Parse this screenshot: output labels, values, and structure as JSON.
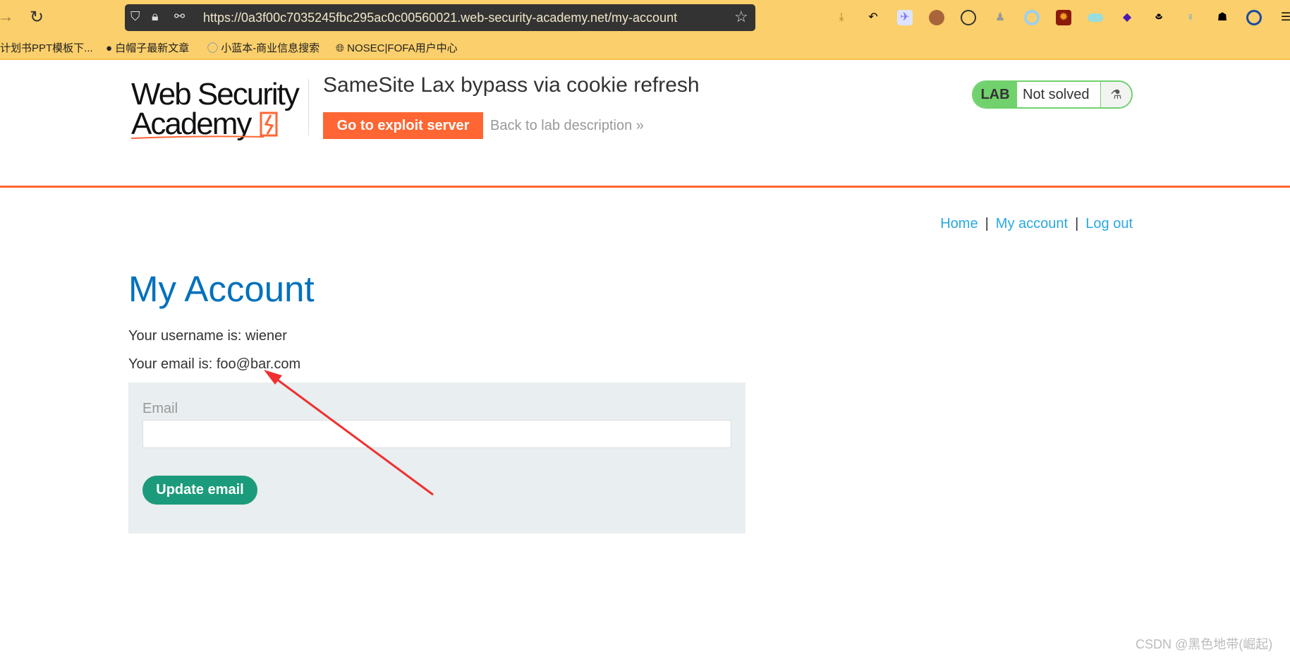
{
  "browser": {
    "url": "https://0a3f00c7035245fbc295ac0c00560021.web-security-academy.net/my-account",
    "bookmarks": [
      "计划书PPT模板下...",
      "白帽子最新文章",
      "小蓝本-商业信息搜索",
      "NOSEC|FOFA用户中心"
    ],
    "extensions": [
      "download-icon",
      "undo-icon",
      "bird-extension-icon",
      "cookie-editor-icon",
      "cookie-icon",
      "spy-icon",
      "ring-icon",
      "sun-tile-icon",
      "toggle-extension-icon",
      "stack-icon",
      "hat-icon",
      "pin-icon",
      "hacker-icon",
      "shield-a-icon",
      "menu-icon"
    ]
  },
  "header": {
    "logo_text": [
      "Web Security",
      "Academy"
    ],
    "title": "SameSite Lax bypass via cookie refresh",
    "exploit_button": "Go to exploit server",
    "back_link": "Back to lab description",
    "back_chevron": "»",
    "lab_badge": "LAB",
    "lab_status": "Not solved",
    "accent": "#ff6633"
  },
  "nav": {
    "home": "Home",
    "my_account": "My account",
    "log_out": "Log out",
    "sep": "|"
  },
  "main": {
    "heading": "My Account",
    "username_line": "Your username is: wiener",
    "email_line": "Your email is: foo@bar.com",
    "form": {
      "email_label": "Email",
      "email_value": "",
      "submit": "Update email"
    }
  },
  "watermark": "CSDN @黑色地带(崛起)"
}
